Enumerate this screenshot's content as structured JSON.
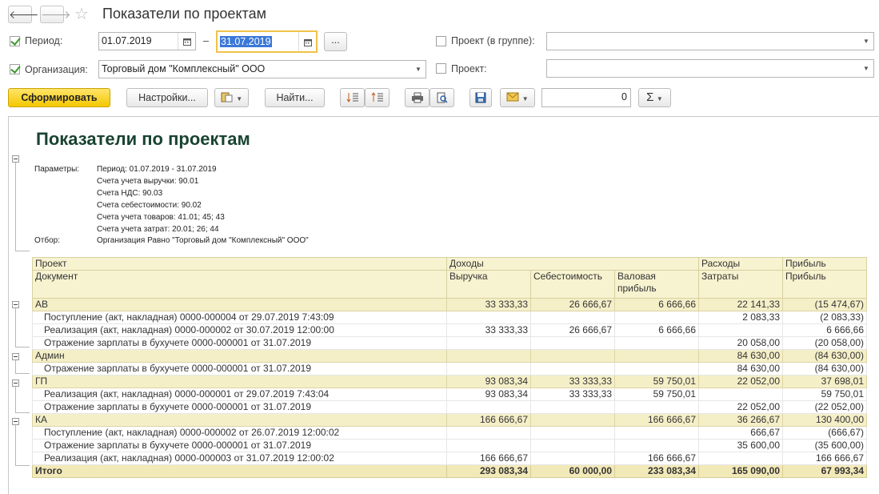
{
  "window": {
    "title": "Показатели по проектам",
    "back_glyph": "🡐",
    "forward_glyph": "🡒",
    "star_glyph": "☆"
  },
  "filters": {
    "period_label": "Период:",
    "date_from": "01.07.2019",
    "date_dash": "–",
    "date_to": "31.07.2019",
    "period_more": "...",
    "org_label": "Организация:",
    "org_value": "Торговый дом \"Комплексный\" ООО",
    "project_group_label": "Проект (в группе):",
    "project_group_value": "",
    "project_label": "Проект:",
    "project_value": ""
  },
  "toolbar": {
    "generate": "Сформировать",
    "settings": "Настройки...",
    "find": "Найти...",
    "counter_value": "0",
    "sum_glyph": "Σ"
  },
  "report": {
    "title": "Показатели по проектам",
    "params_label": "Параметры:",
    "params": [
      "Период: 01.07.2019 - 31.07.2019",
      "Счета учета выручки: 90.01",
      "Счета НДС: 90.03",
      "Счета себестоимости: 90.02",
      "Счета учета товаров: 41.01; 45; 43",
      "Счета учета затрат: 20.01; 26; 44"
    ],
    "filter_label": "Отбор:",
    "filter_value": "Организация Равно \"Торговый дом \"Комплексный\" ООО\"",
    "headers": {
      "project": "Проект",
      "document": "Документ",
      "income": "Доходы",
      "revenue": "Выручка",
      "cost": "Себестоимость",
      "gross_1": "Валовая",
      "gross_2": "прибыль",
      "expenses": "Расходы",
      "costs": "Затраты",
      "profit_top": "Прибыль",
      "profit": "Прибыль"
    },
    "rows": [
      {
        "type": "grp",
        "name": "АВ",
        "revenue": "33 333,33",
        "cost": "26 666,67",
        "gross": "6 666,66",
        "costs": "22 141,33",
        "profit": "(15 474,67)"
      },
      {
        "type": "doc",
        "name": "Поступление (акт, накладная) 0000-000004 от 29.07.2019 7:43:09",
        "revenue": "",
        "cost": "",
        "gross": "",
        "costs": "2 083,33",
        "profit": "(2 083,33)"
      },
      {
        "type": "doc",
        "name": "Реализация (акт, накладная) 0000-000002 от 30.07.2019 12:00:00",
        "revenue": "33 333,33",
        "cost": "26 666,67",
        "gross": "6 666,66",
        "costs": "",
        "profit": "6 666,66"
      },
      {
        "type": "doc",
        "name": "Отражение зарплаты в бухучете 0000-000001 от 31.07.2019",
        "revenue": "",
        "cost": "",
        "gross": "",
        "costs": "20 058,00",
        "profit": "(20 058,00)"
      },
      {
        "type": "grp",
        "name": "Админ",
        "revenue": "",
        "cost": "",
        "gross": "",
        "costs": "84 630,00",
        "profit": "(84 630,00)"
      },
      {
        "type": "doc",
        "name": "Отражение зарплаты в бухучете 0000-000001 от 31.07.2019",
        "revenue": "",
        "cost": "",
        "gross": "",
        "costs": "84 630,00",
        "profit": "(84 630,00)"
      },
      {
        "type": "grp",
        "name": "ГП",
        "revenue": "93 083,34",
        "cost": "33 333,33",
        "gross": "59 750,01",
        "costs": "22 052,00",
        "profit": "37 698,01"
      },
      {
        "type": "doc",
        "name": "Реализация (акт, накладная) 0000-000001 от 29.07.2019 7:43:04",
        "revenue": "93 083,34",
        "cost": "33 333,33",
        "gross": "59 750,01",
        "costs": "",
        "profit": "59 750,01"
      },
      {
        "type": "doc",
        "name": "Отражение зарплаты в бухучете 0000-000001 от 31.07.2019",
        "revenue": "",
        "cost": "",
        "gross": "",
        "costs": "22 052,00",
        "profit": "(22 052,00)"
      },
      {
        "type": "grp",
        "name": "КА",
        "revenue": "166 666,67",
        "cost": "",
        "gross": "166 666,67",
        "costs": "36 266,67",
        "profit": "130 400,00"
      },
      {
        "type": "doc",
        "name": "Поступление (акт, накладная) 0000-000002 от 26.07.2019 12:00:02",
        "revenue": "",
        "cost": "",
        "gross": "",
        "costs": "666,67",
        "profit": "(666,67)"
      },
      {
        "type": "doc",
        "name": "Отражение зарплаты в бухучете 0000-000001 от 31.07.2019",
        "revenue": "",
        "cost": "",
        "gross": "",
        "costs": "35 600,00",
        "profit": "(35 600,00)"
      },
      {
        "type": "doc",
        "name": "Реализация (акт, накладная) 0000-000003 от 31.07.2019 12:00:02",
        "revenue": "166 666,67",
        "cost": "",
        "gross": "166 666,67",
        "costs": "",
        "profit": "166 666,67"
      },
      {
        "type": "tot",
        "name": "Итого",
        "revenue": "293 083,34",
        "cost": "60 000,00",
        "gross": "233 083,34",
        "costs": "165 090,00",
        "profit": "67 993,34"
      }
    ]
  }
}
